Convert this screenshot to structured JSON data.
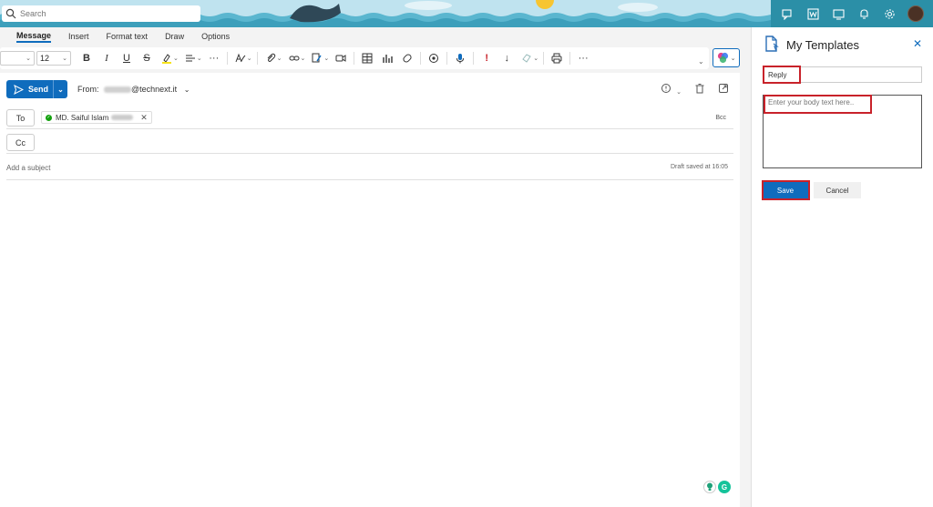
{
  "header": {
    "search_placeholder": "Search",
    "icons": [
      "chat-icon",
      "word-icon",
      "device-icon",
      "bell-icon",
      "gear-icon"
    ]
  },
  "ribbon": {
    "tabs": [
      {
        "label": "Message",
        "active": true
      },
      {
        "label": "Insert",
        "active": false
      },
      {
        "label": "Format text",
        "active": false
      },
      {
        "label": "Draw",
        "active": false
      },
      {
        "label": "Options",
        "active": false
      }
    ],
    "font_size": "12"
  },
  "compose": {
    "send_label": "Send",
    "from_label": "From:",
    "from_domain": "@technext.it",
    "to_label": "To",
    "cc_label": "Cc",
    "bcc_label": "Bcc",
    "recipient_name": "MD. Saiful Islam",
    "subject_placeholder": "Add a subject",
    "draft_status": "Draft saved at 16:05"
  },
  "templates_pane": {
    "title": "My Templates",
    "title_input_value": "Reply",
    "body_placeholder": "Enter your body text here..",
    "save_label": "Save",
    "cancel_label": "Cancel"
  },
  "colors": {
    "accent": "#0f6cbd",
    "header_right": "#2b8fa7",
    "highlight": "#c8222a"
  }
}
